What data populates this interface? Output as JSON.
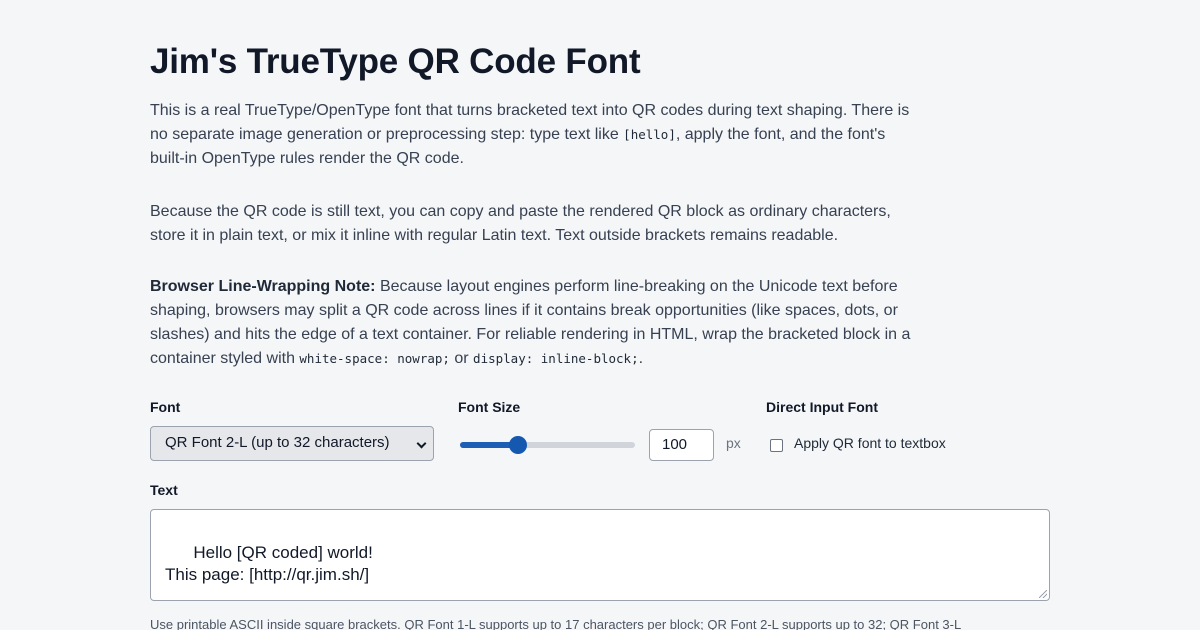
{
  "page": {
    "title": "Jim's TrueType QR Code Font"
  },
  "intro": {
    "p1_a": "This is a real TrueType/OpenType font that turns bracketed text into QR codes during text shaping. There is no separate image generation or preprocessing step: type text like ",
    "p1_code": "[hello]",
    "p1_b": ", apply the font, and the font's built-in OpenType rules render the QR code.",
    "p2": "Because the QR code is still text, you can copy and paste the rendered QR block as ordinary characters, store it in plain text, or mix it inline with regular Latin text. Text outside brackets remains readable.",
    "p3_bold": "Browser Line-Wrapping Note:",
    "p3_a": " Because layout engines perform line-breaking on the Unicode text before shaping, browsers may split a QR code across lines if it contains break opportunities (like spaces, dots, or slashes) and hits the edge of a text container. For reliable rendering in HTML, wrap the bracketed block in a container styled with ",
    "p3_code1": "white-space: nowrap;",
    "p3_or": " or ",
    "p3_code2": "display: inline-block;",
    "p3_end": "."
  },
  "controls": {
    "font_label": "Font",
    "font_selected": "QR Font 2-L (up to 32 characters)",
    "size_label": "Font Size",
    "size_value": "100",
    "size_fraction": 0.33,
    "size_unit": "px",
    "direct_label": "Direct Input Font",
    "direct_checkbox_label": "Apply QR font to textbox",
    "direct_checked": false,
    "text_label": "Text",
    "text_value": "Hello [QR coded] world!\nThis page: [http://qr.jim.sh/]",
    "hint": "Use printable ASCII inside square brackets. QR Font 1-L supports up to 17 characters per block; QR Font 2-L supports up to 32; QR Font 3-L"
  },
  "colors": {
    "accent": "#1558b0",
    "background": "#f5f6f8",
    "heading": "#111827"
  }
}
